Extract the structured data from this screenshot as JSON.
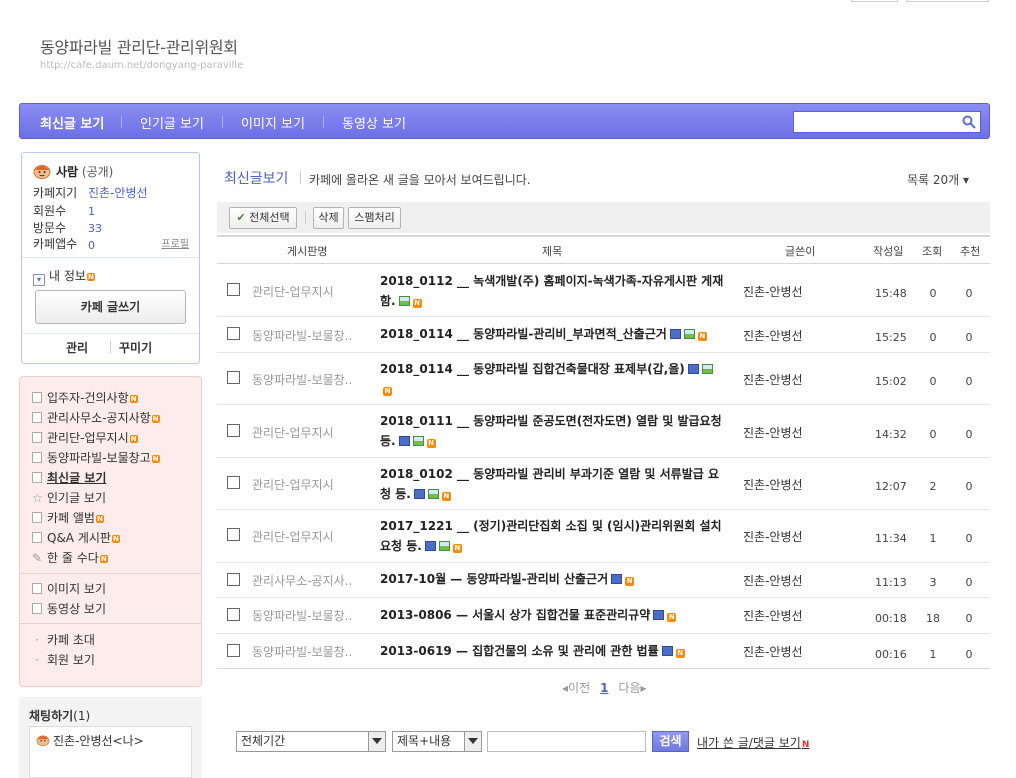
{
  "header": {
    "cafe_title": "동양파라빌 관리단-관리위원회",
    "cafe_url": "http://cafe.daum.net/dongyang-paraville"
  },
  "nav": {
    "items": [
      "최신글 보기",
      "인기글 보기",
      "이미지 보기",
      "동영상 보기"
    ],
    "search_placeholder": ""
  },
  "profile": {
    "role": "사람",
    "visibility": "(공개)",
    "manager_label": "카페지기",
    "manager_value": "진촌-안병선",
    "members_label": "회원수",
    "members_value": "1",
    "visits_label": "방문수",
    "visits_value": "33",
    "app_label": "카페앱수",
    "app_value": "0",
    "profile_link": "프로필",
    "my_info": "내 정보",
    "write_button": "카페 글쓰기",
    "admin_link": "관리",
    "decorate_link": "꾸미기"
  },
  "menu": {
    "boards": [
      "입주자-건의사항",
      "관리사무소-공지사항",
      "관리단-업무지시",
      "동양파라빌-보물창고",
      "최신글 보기",
      "인기글 보기",
      "카페 앨범",
      "Q&A 게시판",
      "한 줄 수다"
    ],
    "media": [
      "이미지 보기",
      "동영상 보기"
    ],
    "links": [
      "카페 초대",
      "회원 보기"
    ]
  },
  "chat": {
    "title": "채팅하기",
    "count": "(1)",
    "user": "진촌-안병선<나>"
  },
  "main": {
    "title": "최신글보기",
    "description": "카페에 올라온 새 글을 모아서 보여드립니다.",
    "list_count": "목록 20개 ▾",
    "select_all": "전체선택",
    "delete": "삭제",
    "spam": "스팸처리"
  },
  "table": {
    "headers": {
      "board": "게시판명",
      "subject": "제목",
      "writer": "글쓴이",
      "date": "작성일",
      "views": "조회",
      "recommend": "추천"
    },
    "rows": [
      {
        "board": "관리단-업무지시",
        "subject": "2018_0112 __ 녹색개발(주) 홈페이지-녹색가족-자유게시판 게재함.",
        "writer": "진촌-안병선",
        "date": "15:48",
        "views": "0",
        "rec": "0"
      },
      {
        "board": "동양파라빌-보물창..",
        "subject": "2018_0114 __ 동양파라빌-관리비_부과면적_산출근거",
        "writer": "진촌-안병선",
        "date": "15:25",
        "views": "0",
        "rec": "0"
      },
      {
        "board": "동양파라빌-보물창..",
        "subject": "2018_0114 __ 동양파라빌 집합건축물대장 표제부(갑,을)",
        "writer": "진촌-안병선",
        "date": "15:02",
        "views": "0",
        "rec": "0"
      },
      {
        "board": "관리단-업무지시",
        "subject": "2018_0111 __ 동양파라빌 준공도면(전자도면) 열람 및 발급요청 등.",
        "writer": "진촌-안병선",
        "date": "14:32",
        "views": "0",
        "rec": "0"
      },
      {
        "board": "관리단-업무지시",
        "subject": "2018_0102 __ 동양파라빌 관리비 부과기준 열람 및 서류발급 요청 등.",
        "writer": "진촌-안병선",
        "date": "12:07",
        "views": "2",
        "rec": "0"
      },
      {
        "board": "관리단-업무지시",
        "subject": "2017_1221 __ (정기)관리단집회 소집 및 (임시)관리위원회 설치 요청 등.",
        "writer": "진촌-안병선",
        "date": "11:34",
        "views": "1",
        "rec": "0"
      },
      {
        "board": "관리사무소-공지사..",
        "subject": "2017-10월 — 동양파라빌-관리비 산출근거",
        "writer": "진촌-안병선",
        "date": "11:13",
        "views": "3",
        "rec": "0"
      },
      {
        "board": "동양파라빌-보물창..",
        "subject": "2013-0806 — 서울시 상가 집합건물 표준관리규약",
        "writer": "진촌-안병선",
        "date": "00:18",
        "views": "18",
        "rec": "0"
      },
      {
        "board": "동양파라빌-보물창..",
        "subject": "2013-0619 — 집합건물의 소유 및 관리에 관한 법률",
        "writer": "진촌-안병선",
        "date": "00:16",
        "views": "1",
        "rec": "0"
      }
    ]
  },
  "pager": {
    "prev": "◂이전",
    "current": "1",
    "next": "다음▸"
  },
  "search": {
    "period": "전체기간",
    "scope": "제목+내용",
    "query": "",
    "button": "검색",
    "my_posts": "내가 쓴 글/댓글 보기"
  }
}
